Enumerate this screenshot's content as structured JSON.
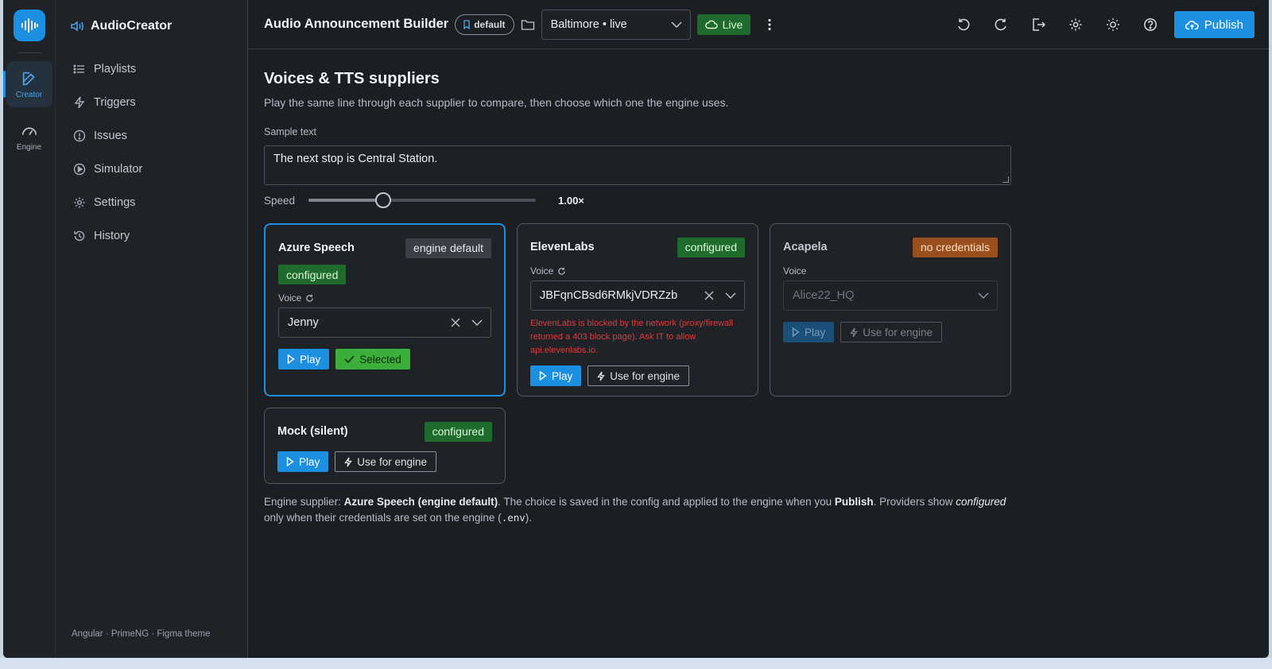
{
  "rail": {
    "items": [
      {
        "label": "Creator",
        "active": true
      },
      {
        "label": "Engine",
        "active": false
      }
    ]
  },
  "sidebar": {
    "brand": "AudioCreator",
    "items": [
      {
        "label": "Playlists",
        "icon": "list-icon"
      },
      {
        "label": "Triggers",
        "icon": "bolt-icon"
      },
      {
        "label": "Issues",
        "icon": "alert-circle-icon"
      },
      {
        "label": "Simulator",
        "icon": "play-circle-icon"
      },
      {
        "label": "Settings",
        "icon": "gear-icon"
      },
      {
        "label": "History",
        "icon": "history-icon"
      }
    ],
    "footer": "Angular · PrimeNG · Figma theme"
  },
  "topbar": {
    "title": "Audio Announcement Builder",
    "branch_pill": "default",
    "environment": "Baltimore • live",
    "live_label": "Live",
    "publish_label": "Publish"
  },
  "page": {
    "title": "Voices & TTS suppliers",
    "subtitle": "Play the same line through each supplier to compare, then choose which one the engine uses.",
    "sample_label": "Sample text",
    "sample_text": "The next stop is Central Station.",
    "speed_label": "Speed",
    "speed_value": "1.00×",
    "speed_fraction": 0.33
  },
  "cards": {
    "azure": {
      "name": "Azure Speech",
      "tag": "engine default",
      "status": "configured",
      "voice_label": "Voice",
      "voice": "Jenny",
      "play": "Play",
      "selected": "Selected"
    },
    "eleven": {
      "name": "ElevenLabs",
      "status": "configured",
      "voice_label": "Voice",
      "voice": "JBFqnCBsd6RMkjVDRZzb",
      "error": "ElevenLabs is blocked by the network (proxy/firewall returned a 403 block page). Ask IT to allow api.elevenlabs.io.",
      "play": "Play",
      "use": "Use for engine"
    },
    "acapela": {
      "name": "Acapela",
      "status": "no credentials",
      "voice_label": "Voice",
      "voice": "Alice22_HQ",
      "play": "Play",
      "use": "Use for engine"
    },
    "mock": {
      "name": "Mock (silent)",
      "status": "configured",
      "play": "Play",
      "use": "Use for engine"
    }
  },
  "footnote": {
    "p1": "Engine supplier: ",
    "engine": "Azure Speech (engine default)",
    "p2": ". The choice is saved in the config and applied to the engine when you ",
    "publish": "Publish",
    "p3": ". Providers show ",
    "configured": "configured",
    "p4": " only when their credentials are set on the engine (",
    "env": ".env",
    "p5": ")."
  },
  "colors": {
    "accent": "#1c8fe0",
    "success": "#1f6b2d",
    "warning": "#9a4f1e",
    "error": "#e03a3a"
  }
}
